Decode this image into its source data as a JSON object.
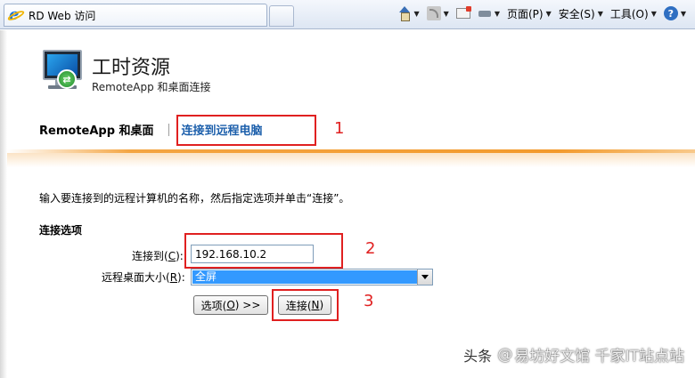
{
  "browser": {
    "tab_title": "RD Web 访问",
    "toolbar": {
      "page_menu": "页面(P)",
      "safety_menu": "安全(S)",
      "tools_menu": "工具(O)",
      "help_icon": "?"
    }
  },
  "header": {
    "title": "工时资源",
    "subtitle": "RemoteApp 和桌面连接",
    "badge_glyph": "⇄"
  },
  "nav": {
    "home": "RemoteApp 和桌面",
    "active": "连接到远程电脑"
  },
  "content": {
    "instructions": "输入要连接到的远程计算机的名称，然后指定选项并单击“连接”。",
    "section_title": "连接选项",
    "connect_to_label_a": "连接到(",
    "connect_to_label_key": "C",
    "connect_to_label_b": "):",
    "connect_to_value": "192.168.10.2",
    "size_label_a": "远程桌面大小(",
    "size_label_key": "R",
    "size_label_b": "):",
    "size_value": "全屏",
    "options_button_a": "选项(",
    "options_button_key": "O",
    "options_button_b": ") >>",
    "connect_button_a": "连接(",
    "connect_button_key": "N",
    "connect_button_b": ")"
  },
  "annotations": {
    "step1": "1",
    "step2": "2",
    "step3": "3",
    "annotation_color": "#e02020"
  },
  "watermark": {
    "prefix": "头条",
    "at": "@",
    "text": "易坊好文馆 千家IT站点站"
  },
  "colors": {
    "accent_orange": "#f39a2c",
    "link_blue": "#1c5fab",
    "selection_blue": "#3399ff"
  }
}
